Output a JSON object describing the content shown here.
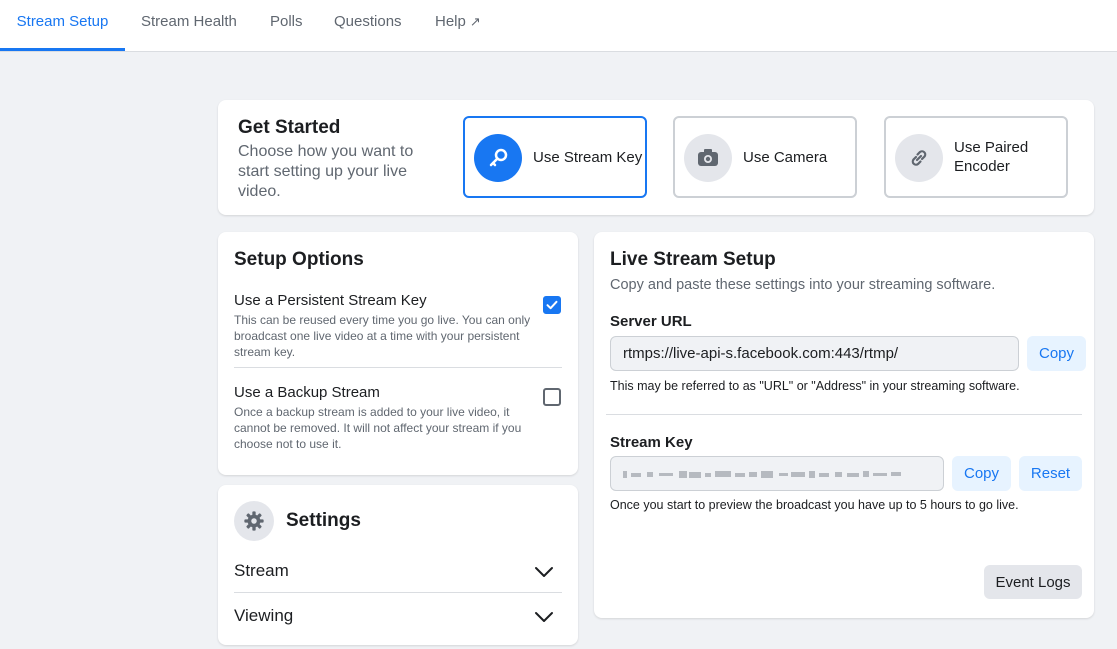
{
  "tabs": [
    {
      "label": "Stream Setup",
      "active": true
    },
    {
      "label": "Stream Health"
    },
    {
      "label": "Polls"
    },
    {
      "label": "Questions"
    },
    {
      "label": "Help",
      "icon": "external-link-icon"
    }
  ],
  "get_started": {
    "title": "Get Started",
    "subtitle": "Choose how you want to start setting up your live video.",
    "options": [
      {
        "label": "Use Stream Key",
        "icon": "key-icon",
        "selected": true
      },
      {
        "label": "Use Camera",
        "icon": "camera-icon"
      },
      {
        "label": "Use Paired Encoder",
        "icon": "link-icon"
      }
    ]
  },
  "setup_options": {
    "title": "Setup Options",
    "items": [
      {
        "title": "Use a Persistent Stream Key",
        "description": "This can be reused every time you go live. You can only broadcast one live video at a time with your persistent stream key.",
        "checked": true
      },
      {
        "title": "Use a Backup Stream",
        "description": "Once a backup stream is added to your live video, it cannot be removed. It will not affect your stream if you choose not to use it.",
        "checked": false
      }
    ]
  },
  "settings": {
    "title": "Settings",
    "icon": "gear-icon",
    "items": [
      {
        "label": "Stream"
      },
      {
        "label": "Viewing"
      }
    ]
  },
  "live_stream_setup": {
    "title": "Live Stream Setup",
    "subtitle": "Copy and paste these settings into your streaming software.",
    "server_url": {
      "label": "Server URL",
      "value": "rtmps://live-api-s.facebook.com:443/rtmp/",
      "copy_label": "Copy",
      "helper": "This may be referred to as \"URL\" or \"Address\" in your streaming software."
    },
    "stream_key": {
      "label": "Stream Key",
      "copy_label": "Copy",
      "reset_label": "Reset",
      "helper": "Once you start to preview the broadcast you have up to 5 hours to go live."
    },
    "event_logs_label": "Event Logs"
  },
  "colors": {
    "accent": "#1877f2",
    "background": "#f0f2f5",
    "button_light": "#e7f3ff"
  }
}
